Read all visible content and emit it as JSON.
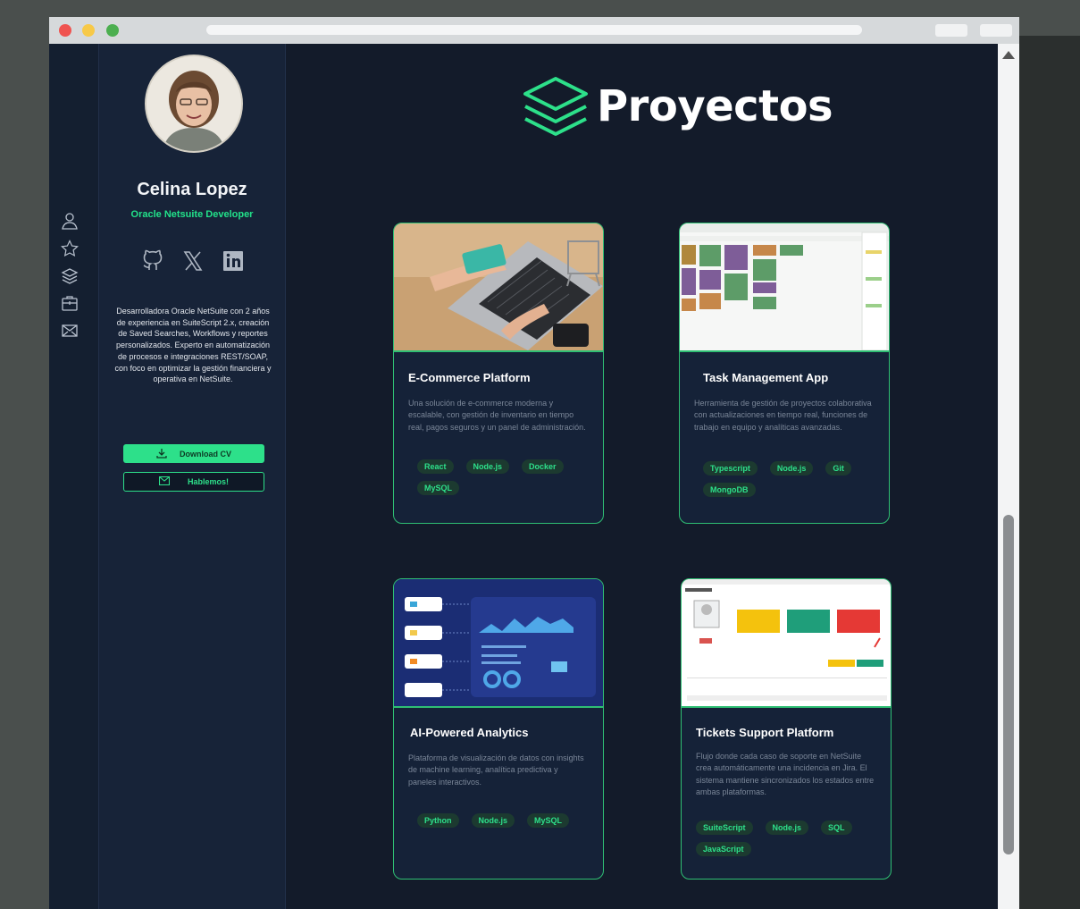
{
  "window": {
    "url": ""
  },
  "rail": {
    "icons": [
      "user-icon",
      "star-icon",
      "layers-icon",
      "briefcase-icon",
      "mail-icon"
    ]
  },
  "profile": {
    "name": "Celina Lopez",
    "role": "Oracle Netsuite Developer",
    "socials": [
      "github-icon",
      "x-icon",
      "linkedin-icon"
    ],
    "bio": "Desarrolladora Oracle NetSuite con 2 años de experiencia en SuiteScript 2.x, creación de Saved Searches, Workflows y reportes personalizados. Experto en automatización de procesos e integraciones REST/SOAP, con foco en optimizar la gestión financiera y operativa en NetSuite.",
    "download_label": "Download CV",
    "contact_label": "Hablemos!"
  },
  "main": {
    "title": "Proyectos",
    "projects": [
      {
        "title": "E-Commerce Platform",
        "description": "Una solución de e-commerce moderna y escalable, con gestión de inventario en tiempo real, pagos seguros y un panel de administración.",
        "tags": [
          "React",
          "Node.js",
          "Docker",
          "MySQL"
        ]
      },
      {
        "title": "Task Management App",
        "description": "Herramienta de gestión de proyectos colaborativa con actualizaciones en tiempo real, funciones de trabajo en equipo y analíticas avanzadas.",
        "tags": [
          "Typescript",
          "Node.js",
          "Git",
          "MongoDB"
        ]
      },
      {
        "title": "AI-Powered Analytics",
        "description": "Plataforma de visualización de datos con insights de machine learning, analítica predictiva y paneles interactivos.",
        "tags": [
          "Python",
          "Node.js",
          "MySQL"
        ]
      },
      {
        "title": "Tickets Support Platform",
        "description": "Flujo donde cada caso de soporte en NetSuite crea automáticamente una incidencia en Jira. El sistema mantiene sincronizados los estados entre ambas plataformas.",
        "tags": [
          "SuiteScript",
          "Node.js",
          "SQL",
          "JavaScript"
        ]
      }
    ]
  },
  "colors": {
    "accent": "#2de08a",
    "background": "#131b2a",
    "sidebar": "#172338",
    "card": "#152238"
  }
}
